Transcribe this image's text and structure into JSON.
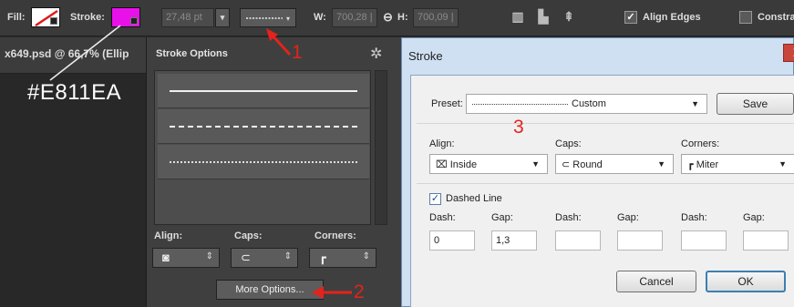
{
  "toolbar": {
    "fill_label": "Fill:",
    "stroke_label": "Stroke:",
    "stroke_color": "#E811EA",
    "width_value": "27,48 pt",
    "w_label": "W:",
    "w_value": "700,28 |",
    "h_label": "H:",
    "h_value": "700,09 |",
    "align_edges_label": "Align Edges",
    "align_edges_checked": true,
    "constrain_label": "Constra"
  },
  "document": {
    "tab_title": "x649.psd @ 66,7% (Ellip",
    "color_callout": "#E811EA"
  },
  "stroke_panel": {
    "title": "Stroke Options",
    "align_label": "Align:",
    "caps_label": "Caps:",
    "corners_label": "Corners:",
    "more_options_label": "More Options..."
  },
  "dialog": {
    "title": "Stroke",
    "close_glyph": "X",
    "preset_label": "Preset:",
    "preset_value": "Custom",
    "save_label": "Save",
    "align_label": "Align:",
    "align_value": "Inside",
    "caps_label": "Caps:",
    "caps_value": "Round",
    "corners_label": "Corners:",
    "corners_value": "Miter",
    "dashed_line_label": "Dashed Line",
    "dashed_checked": true,
    "dash_gap_headers": [
      "Dash:",
      "Gap:",
      "Dash:",
      "Gap:",
      "Dash:",
      "Gap:"
    ],
    "dash_gap_values": [
      "0",
      "1,3",
      "",
      "",
      "",
      ""
    ],
    "cancel_label": "Cancel",
    "ok_label": "OK"
  },
  "annotations": {
    "step1": "1",
    "step2": "2",
    "step3": "3",
    "color": "#e3231c"
  }
}
